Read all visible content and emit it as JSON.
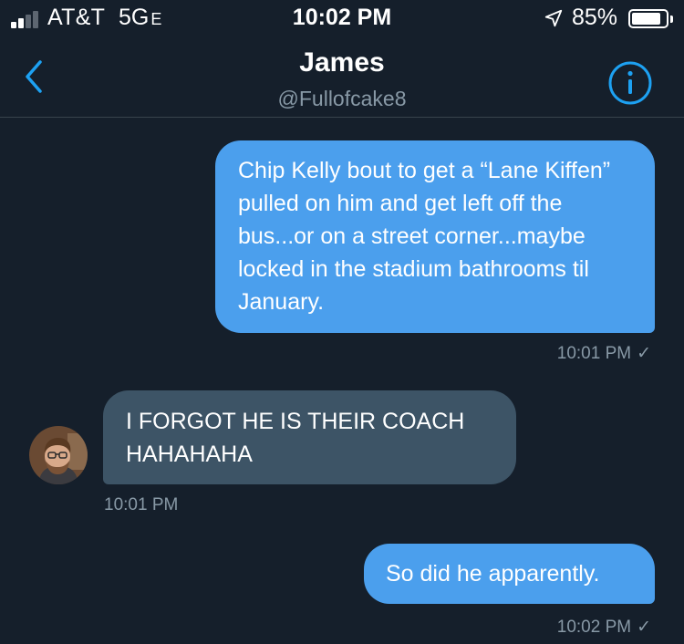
{
  "status_bar": {
    "carrier": "AT&T",
    "network": "5G",
    "network_suffix": "E",
    "time": "10:02 PM",
    "battery_percent": "85%",
    "battery_level": 0.85,
    "signal_bars": {
      "filled": 2,
      "total": 4
    },
    "location_icon": "location-arrow-icon"
  },
  "header": {
    "title": "James",
    "handle": "@Fullofcake8",
    "back_icon": "chevron-left-icon",
    "info_icon": "info-icon"
  },
  "messages": [
    {
      "direction": "outgoing",
      "text": "Chip Kelly bout to get a “Lane Kiffen” pulled on him and get left off the bus...or on a street corner...maybe locked in the stadium bathrooms til January.",
      "time": "10:01 PM",
      "check": "✓"
    },
    {
      "direction": "incoming",
      "text": "I FORGOT HE IS THEIR COACH HAHAHAHA",
      "time": "10:01 PM"
    },
    {
      "direction": "outgoing",
      "text": "So did he apparently.",
      "time": "10:02 PM",
      "check": "✓"
    }
  ],
  "colors": {
    "background": "#151f2b",
    "outgoing_bubble": "#4b9fed",
    "incoming_bubble": "#3d5466",
    "accent": "#1da1f2",
    "secondary_text": "#8899a6"
  }
}
